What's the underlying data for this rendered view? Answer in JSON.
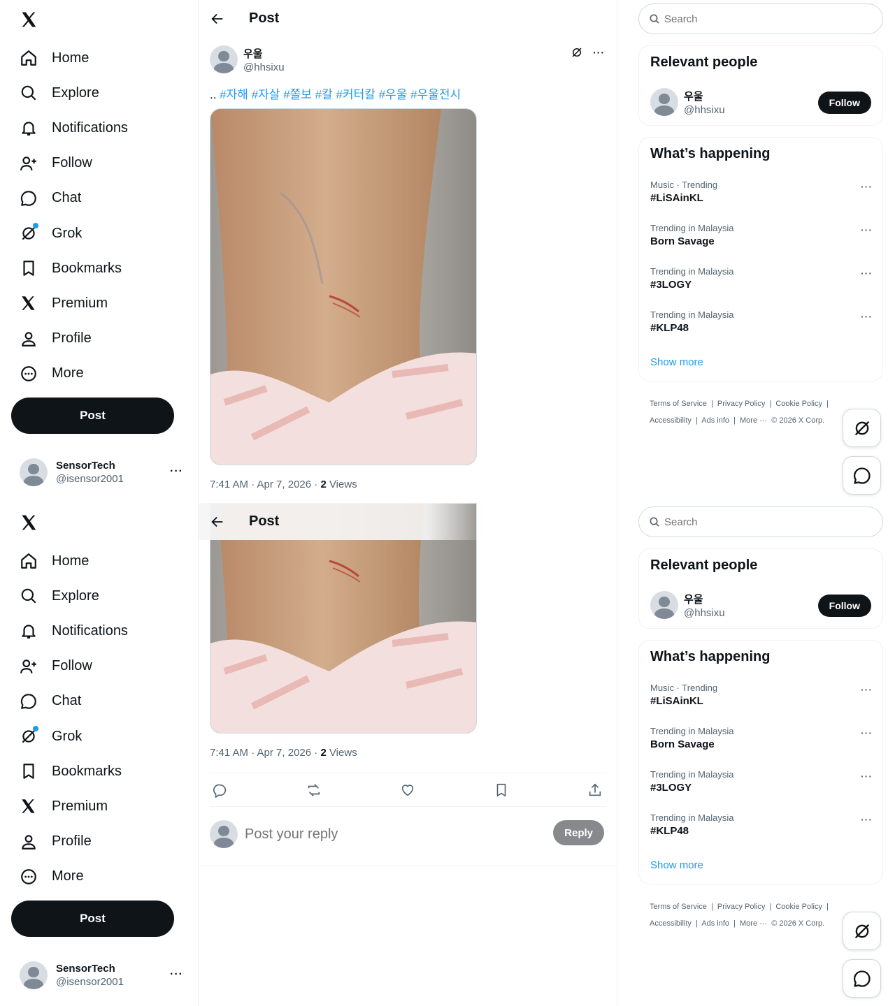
{
  "nav": {
    "items": [
      {
        "label": "Home",
        "icon": "home-icon"
      },
      {
        "label": "Explore",
        "icon": "search-icon"
      },
      {
        "label": "Notifications",
        "icon": "bell-icon"
      },
      {
        "label": "Follow",
        "icon": "person-add-icon"
      },
      {
        "label": "Chat",
        "icon": "chat-bubble-icon"
      },
      {
        "label": "Grok",
        "icon": "grok-icon"
      },
      {
        "label": "Bookmarks",
        "icon": "bookmark-icon"
      },
      {
        "label": "Premium",
        "icon": "x-logo-icon"
      },
      {
        "label": "Profile",
        "icon": "person-icon"
      },
      {
        "label": "More",
        "icon": "more-circle-icon"
      }
    ],
    "post_button": "Post"
  },
  "account": {
    "name": "SensorTech",
    "handle": "@isensor2001"
  },
  "main": {
    "header_title": "Post",
    "author": {
      "name": "우울",
      "handle": "@hhsixu"
    },
    "text_prefix": "..",
    "hashtags": [
      "#자해",
      "#자살",
      "#쫄보",
      "#칼",
      "#커터칼",
      "#우울",
      "#우울전시"
    ],
    "timestamp": "7:41 AM · Apr 7, 2026 · ",
    "views_count": "2",
    "views_label": " Views",
    "reply_placeholder": "Post your reply",
    "reply_button": "Reply"
  },
  "sidebar": {
    "search_placeholder": "Search",
    "relevant_title": "Relevant people",
    "relevant_user": {
      "name": "우울",
      "handle": "@hhsixu"
    },
    "follow_button": "Follow",
    "happening_title": "What’s happening",
    "trends": [
      {
        "meta": "Music · Trending",
        "name": "#LiSAinKL"
      },
      {
        "meta": "Trending in Malaysia",
        "name": "Born Savage"
      },
      {
        "meta": "Trending in Malaysia",
        "name": "#3LOGY"
      },
      {
        "meta": "Trending in Malaysia",
        "name": "#KLP48"
      }
    ],
    "show_more": "Show more",
    "footer": [
      "Terms of Service",
      "|",
      "Privacy Policy",
      "|",
      "Cookie Policy",
      "|",
      "Accessibility",
      "|",
      "Ads info",
      "|",
      "More ···",
      "© 2026 X Corp."
    ]
  },
  "colors": {
    "accent": "#1d9bf0",
    "text": "#0f1419",
    "muted": "#536471",
    "border": "#eff3f4"
  }
}
